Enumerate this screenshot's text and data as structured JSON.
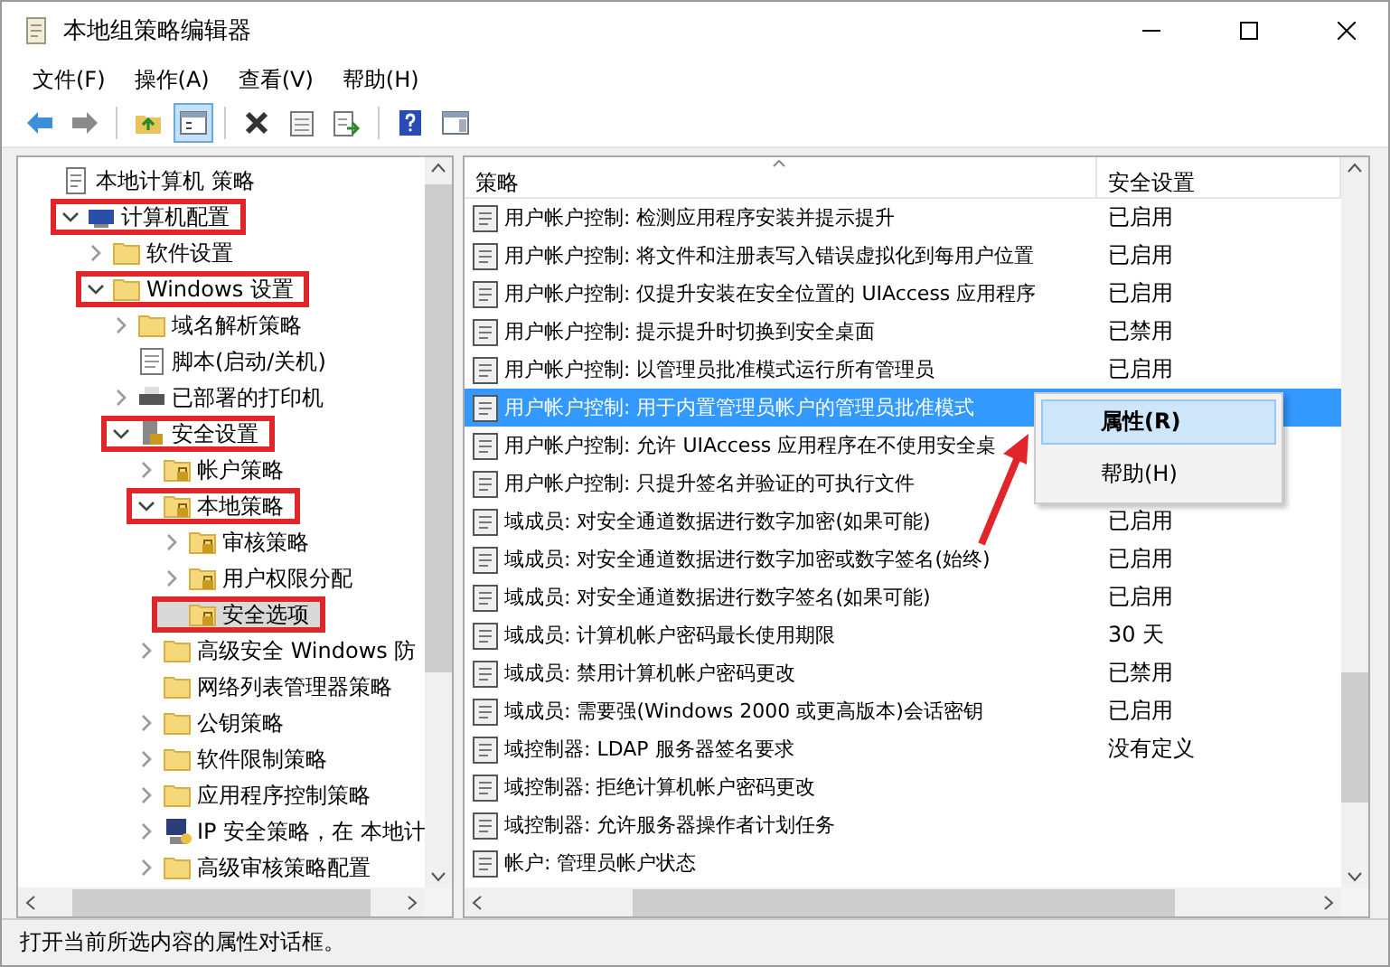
{
  "window": {
    "title": "本地组策略编辑器"
  },
  "menu": [
    "文件(F)",
    "操作(A)",
    "查看(V)",
    "帮助(H)"
  ],
  "toolbar": [
    [
      {
        "kind": "back",
        "pressed": false
      },
      {
        "kind": "forward",
        "pressed": false
      }
    ],
    [
      {
        "kind": "up",
        "pressed": false
      },
      {
        "kind": "tree",
        "pressed": true
      }
    ],
    [
      {
        "kind": "delete",
        "pressed": false
      },
      {
        "kind": "properties",
        "pressed": false
      },
      {
        "kind": "export",
        "pressed": false
      }
    ],
    [
      {
        "kind": "help",
        "pressed": false
      },
      {
        "kind": "pane",
        "pressed": false
      }
    ]
  ],
  "tree": [
    {
      "label": "本地计算机 策略",
      "kind": "doc",
      "highlighted": false,
      "selected": false,
      "children": [
        {
          "label": "计算机配置",
          "kind": "computer",
          "expanded": true,
          "highlighted": true,
          "selected": false,
          "children": [
            {
              "label": "软件设置",
              "kind": "folder",
              "expanded": false,
              "highlighted": false,
              "selected": false
            },
            {
              "label": "Windows 设置",
              "kind": "folder",
              "expanded": true,
              "highlighted": true,
              "selected": false,
              "children": [
                {
                  "label": "域名解析策略",
                  "kind": "folder",
                  "expanded": false,
                  "highlighted": false,
                  "selected": false
                },
                {
                  "label": "脚本(启动/关机)",
                  "kind": "script",
                  "highlighted": false,
                  "selected": false
                },
                {
                  "label": "已部署的打印机",
                  "kind": "printer",
                  "expanded": false,
                  "highlighted": false,
                  "selected": false
                },
                {
                  "label": "安全设置",
                  "kind": "security",
                  "expanded": true,
                  "highlighted": true,
                  "selected": false,
                  "children": [
                    {
                      "label": "帐户策略",
                      "kind": "lockfolder",
                      "expanded": false,
                      "highlighted": false,
                      "selected": false
                    },
                    {
                      "label": "本地策略",
                      "kind": "lockfolder",
                      "expanded": true,
                      "highlighted": true,
                      "selected": false,
                      "children": [
                        {
                          "label": "审核策略",
                          "kind": "lockfolder",
                          "expanded": false,
                          "highlighted": false,
                          "selected": false
                        },
                        {
                          "label": "用户权限分配",
                          "kind": "lockfolder",
                          "expanded": false,
                          "highlighted": false,
                          "selected": false
                        },
                        {
                          "label": "安全选项",
                          "kind": "lockfolder",
                          "highlighted": true,
                          "selected": true
                        }
                      ]
                    },
                    {
                      "label": "高级安全 Windows 防",
                      "kind": "folder",
                      "expanded": false,
                      "highlighted": false,
                      "selected": false
                    },
                    {
                      "label": "网络列表管理器策略",
                      "kind": "folder",
                      "highlighted": false,
                      "selected": false
                    },
                    {
                      "label": "公钥策略",
                      "kind": "folder",
                      "expanded": false,
                      "highlighted": false,
                      "selected": false
                    },
                    {
                      "label": "软件限制策略",
                      "kind": "folder",
                      "expanded": false,
                      "highlighted": false,
                      "selected": false
                    },
                    {
                      "label": "应用程序控制策略",
                      "kind": "folder",
                      "expanded": false,
                      "highlighted": false,
                      "selected": false
                    },
                    {
                      "label": "IP 安全策略，在 本地计",
                      "kind": "ip",
                      "expanded": false,
                      "highlighted": false,
                      "selected": false
                    },
                    {
                      "label": "高级审核策略配置",
                      "kind": "folder",
                      "expanded": false,
                      "highlighted": false,
                      "selected": false
                    }
                  ]
                }
              ]
            }
          ]
        }
      ]
    }
  ],
  "table": {
    "columns": [
      "策略",
      "安全设置"
    ],
    "rows": [
      {
        "policy": "用户帐户控制: 检测应用程序安装并提示提升",
        "setting": "已启用",
        "selected": false
      },
      {
        "policy": "用户帐户控制: 将文件和注册表写入错误虚拟化到每用户位置",
        "setting": "已启用",
        "selected": false
      },
      {
        "policy": "用户帐户控制: 仅提升安装在安全位置的 UIAccess 应用程序",
        "setting": "已启用",
        "selected": false
      },
      {
        "policy": "用户帐户控制: 提示提升时切换到安全桌面",
        "setting": "已禁用",
        "selected": false
      },
      {
        "policy": "用户帐户控制: 以管理员批准模式运行所有管理员",
        "setting": "已启用",
        "selected": false
      },
      {
        "policy": "用户帐户控制: 用于内置管理员帐户的管理员批准模式",
        "selected": true
      },
      {
        "policy": "用户帐户控制: 允许 UIAccess 应用程序在不使用安全桌",
        "selected": false
      },
      {
        "policy": "用户帐户控制: 只提升签名并验证的可执行文件",
        "selected": false
      },
      {
        "policy": "域成员: 对安全通道数据进行数字加密(如果可能)",
        "setting": "已启用",
        "selected": false
      },
      {
        "policy": "域成员: 对安全通道数据进行数字加密或数字签名(始终)",
        "setting": "已启用",
        "selected": false
      },
      {
        "policy": "域成员: 对安全通道数据进行数字签名(如果可能)",
        "setting": "已启用",
        "selected": false
      },
      {
        "policy": "域成员: 计算机帐户密码最长使用期限",
        "setting": "30 天",
        "selected": false
      },
      {
        "policy": "域成员: 禁用计算机帐户密码更改",
        "setting": "已禁用",
        "selected": false
      },
      {
        "policy": "域成员: 需要强(Windows 2000 或更高版本)会话密钥",
        "setting": "已启用",
        "selected": false
      },
      {
        "policy": "域控制器: LDAP 服务器签名要求",
        "setting": "没有定义",
        "selected": false
      },
      {
        "policy": "域控制器: 拒绝计算机帐户密码更改",
        "selected": false
      },
      {
        "policy": "域控制器: 允许服务器操作者计划任务",
        "selected": false
      },
      {
        "policy": "帐户: 管理员帐户状态",
        "selected": false
      }
    ]
  },
  "context_menu": [
    {
      "label": "属性(R)",
      "default": true,
      "selected": true
    },
    {
      "label": "帮助(H)",
      "default": false,
      "selected": false
    }
  ],
  "status_bar": "打开当前所选内容的属性对话框。"
}
